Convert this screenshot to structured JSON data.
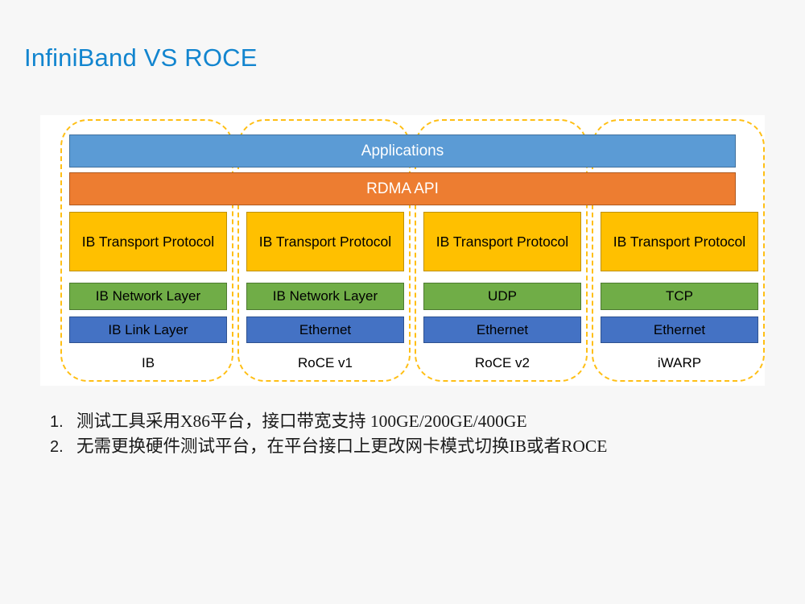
{
  "slide": {
    "title": "InfiniBand VS ROCE",
    "title_color": "#1285cf",
    "background_color": "#f7f7f7"
  },
  "diagram": {
    "panel_background": "#ffffff",
    "group_border_color": "#ffbf15",
    "shared_bars": [
      {
        "id": "applications",
        "label": "Applications",
        "color": "#5b9bd5"
      },
      {
        "id": "rdma-api",
        "label": "RDMA API",
        "color": "#ed7d31"
      }
    ],
    "row_colors": {
      "transport": "#ffc000",
      "network": "#70ad47",
      "link": "#4472c4"
    },
    "columns": [
      {
        "name": "IB",
        "transport": "IB Transport Protocol",
        "network": "IB Network Layer",
        "link": "IB Link Layer"
      },
      {
        "name": "RoCE v1",
        "transport": "IB Transport Protocol",
        "network": "IB Network Layer",
        "link": "Ethernet"
      },
      {
        "name": "RoCE v2",
        "transport": "IB Transport Protocol",
        "network": "UDP",
        "link": "Ethernet"
      },
      {
        "name": "iWARP",
        "transport": "IB Transport Protocol",
        "network": "TCP",
        "link": "Ethernet"
      }
    ]
  },
  "bullets": [
    {
      "number": "1.",
      "text": "测试工具采用X86平台，接口带宽支持 100GE/200GE/400GE"
    },
    {
      "number": "2.",
      "text": "无需更换硬件测试平台，在平台接口上更改网卡模式切换IB或者ROCE"
    }
  ]
}
